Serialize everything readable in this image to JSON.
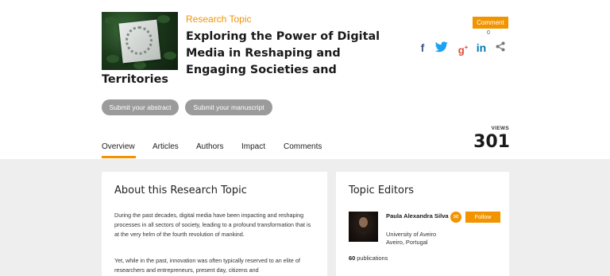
{
  "header": {
    "kicker": "Research Topic",
    "title_lines": "Exploring the Power of Digital Media in Reshaping and Engaging Societies and",
    "title_tail": "Territories",
    "buttons": {
      "submit_abstract": "Submit your abstract",
      "submit_manuscript": "Submit your manuscript"
    },
    "comment_label": "Comment",
    "comment_count": "0",
    "social": [
      "facebook-icon",
      "twitter-icon",
      "google-plus-icon",
      "linkedin-icon",
      "share-icon"
    ],
    "views_label": "VIEWS",
    "views_count": "301"
  },
  "tabs": [
    {
      "label": "Overview",
      "active": true
    },
    {
      "label": "Articles"
    },
    {
      "label": "Authors"
    },
    {
      "label": "Impact"
    },
    {
      "label": "Comments"
    }
  ],
  "about": {
    "title": "About this Research Topic",
    "p1": "During the past decades, digital media have been impacting and reshaping processes in all sectors of society, leading to a profound transformation that is at the very helm of the fourth revolution of mankind.",
    "p2": "Yet, while in the past, innovation was often typically reserved to an elite of researchers and entrepreneurs, present day, citizens and"
  },
  "editors": {
    "title": "Topic Editors",
    "items": [
      {
        "name": "Paula Alexandra Silva",
        "institution": "University of Aveiro",
        "location": "Aveiro, Portugal",
        "follow_label": "Follow",
        "pubs_count": "60",
        "pubs_label": "publications"
      }
    ]
  },
  "colors": {
    "accent": "#f29400",
    "grey_button": "#9b9b9b",
    "page_bg": "#eeeeee"
  }
}
